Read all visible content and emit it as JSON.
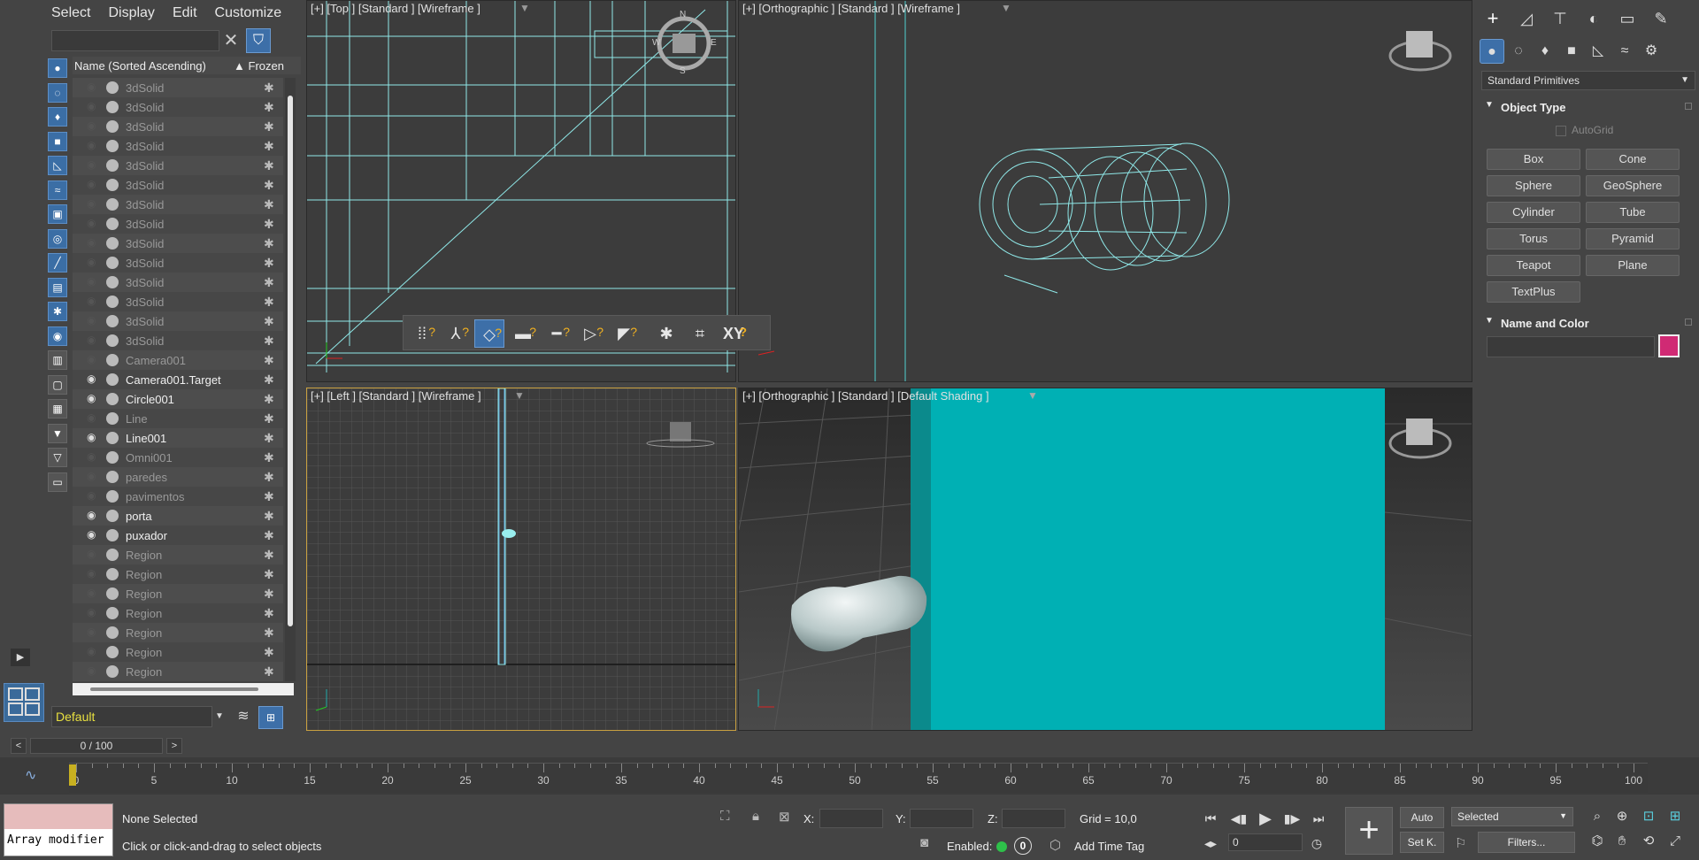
{
  "menu": [
    "Select",
    "Display",
    "Edit",
    "Customize"
  ],
  "explorer": {
    "search_placeholder": "",
    "col_name": "Name (Sorted Ascending)",
    "col_frozen": "Frozen",
    "sort_indicator": "▲",
    "rows": [
      {
        "name": "3dSolid",
        "eye": false,
        "bright": false
      },
      {
        "name": "3dSolid",
        "eye": false,
        "bright": false
      },
      {
        "name": "3dSolid",
        "eye": false,
        "bright": false
      },
      {
        "name": "3dSolid",
        "eye": false,
        "bright": false
      },
      {
        "name": "3dSolid",
        "eye": false,
        "bright": false
      },
      {
        "name": "3dSolid",
        "eye": false,
        "bright": false
      },
      {
        "name": "3dSolid",
        "eye": false,
        "bright": false
      },
      {
        "name": "3dSolid",
        "eye": false,
        "bright": false
      },
      {
        "name": "3dSolid",
        "eye": false,
        "bright": false
      },
      {
        "name": "3dSolid",
        "eye": false,
        "bright": false
      },
      {
        "name": "3dSolid",
        "eye": false,
        "bright": false
      },
      {
        "name": "3dSolid",
        "eye": false,
        "bright": false
      },
      {
        "name": "3dSolid",
        "eye": false,
        "bright": false
      },
      {
        "name": "3dSolid",
        "eye": false,
        "bright": false
      },
      {
        "name": "Camera001",
        "eye": false,
        "bright": false
      },
      {
        "name": "Camera001.Target",
        "eye": true,
        "bright": true
      },
      {
        "name": "Circle001",
        "eye": true,
        "bright": true
      },
      {
        "name": "Line",
        "eye": false,
        "bright": false
      },
      {
        "name": "Line001",
        "eye": true,
        "bright": true
      },
      {
        "name": "Omni001",
        "eye": false,
        "bright": false
      },
      {
        "name": "paredes",
        "eye": false,
        "bright": false
      },
      {
        "name": "pavimentos",
        "eye": false,
        "bright": false
      },
      {
        "name": "porta",
        "eye": true,
        "bright": true
      },
      {
        "name": "puxador",
        "eye": true,
        "bright": true
      },
      {
        "name": "Region",
        "eye": false,
        "bright": false
      },
      {
        "name": "Region",
        "eye": false,
        "bright": false
      },
      {
        "name": "Region",
        "eye": false,
        "bright": false
      },
      {
        "name": "Region",
        "eye": false,
        "bright": false
      },
      {
        "name": "Region",
        "eye": false,
        "bright": false
      },
      {
        "name": "Region",
        "eye": false,
        "bright": false
      },
      {
        "name": "Region",
        "eye": false,
        "bright": false
      }
    ],
    "layer": "Default"
  },
  "viewports": {
    "top_label": "[+] [Top ] [Standard ] [Wireframe ]",
    "persp1_label": "[+] [Orthographic ] [Standard ] [Wireframe ]",
    "left_label": "[+] [Left ] [Standard ] [Wireframe ]",
    "persp2_label": "[+] [Orthographic ] [Standard ] [Default Shading ]",
    "compass": {
      "n": "N",
      "s": "S",
      "e": "E",
      "w": "W"
    }
  },
  "snap_toolbar": {
    "xy_label": "XY"
  },
  "command_panel": {
    "category": "Standard Primitives",
    "object_type_title": "Object Type",
    "autogrid": "AutoGrid",
    "primitives": [
      "Box",
      "Cone",
      "Sphere",
      "GeoSphere",
      "Cylinder",
      "Tube",
      "Torus",
      "Pyramid",
      "Teapot",
      "Plane",
      "TextPlus"
    ],
    "name_color_title": "Name and Color",
    "object_color": "#d02a74"
  },
  "timeline": {
    "slider": "0 / 100",
    "prev": "<",
    "next": ">",
    "ticks": [
      0,
      5,
      10,
      15,
      20,
      25,
      30,
      35,
      40,
      45,
      50,
      55,
      60,
      65,
      70,
      75,
      80,
      85,
      90,
      95,
      100
    ]
  },
  "status": {
    "maxscript": "Array modifier",
    "selection": "None Selected",
    "prompt": "Click or click-and-drag to select objects",
    "x_label": "X:",
    "y_label": "Y:",
    "z_label": "Z:",
    "grid": "Grid = 10,0",
    "enabled": "Enabled:",
    "enabled_count": "0",
    "add_time_tag": "Add Time Tag",
    "frame": "0",
    "auto": "Auto",
    "set_key": "Set K.",
    "selected": "Selected",
    "filters": "Filters..."
  }
}
